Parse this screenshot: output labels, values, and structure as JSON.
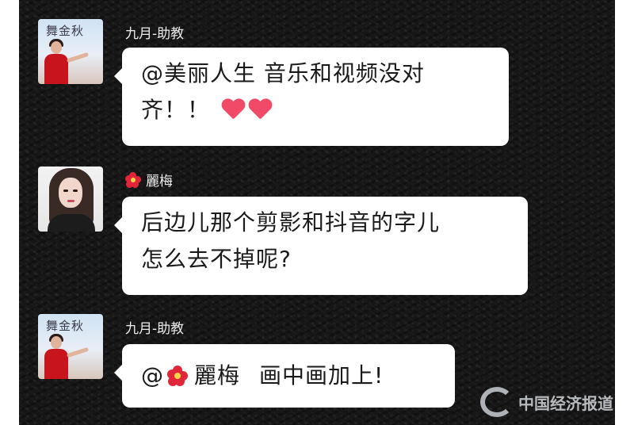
{
  "messages": [
    {
      "sender": "九月-助教",
      "avatar": "teacher-avatar",
      "avatar_sign": "舞金秋",
      "lines": [
        "@美丽人生  音乐和视频没对",
        "齐！！"
      ],
      "emoji": "two-hearts"
    },
    {
      "sender": "麗梅",
      "sender_icon": "hibiscus-icon",
      "avatar": "lady-avatar",
      "lines": [
        "后边儿那个剪影和抖音的字儿",
        "怎么去不掉呢?"
      ]
    },
    {
      "sender": "九月-助教",
      "avatar": "teacher-avatar",
      "avatar_sign": "舞金秋",
      "mention_prefix": "@",
      "mention_name": "麗梅",
      "text": "画中画加上!"
    }
  ],
  "watermark": {
    "text": "中国经济报道"
  },
  "colors": {
    "background": "#161616",
    "bubble": "#ffffff",
    "heart": "#f04a68",
    "hibiscus": "#e2263a"
  }
}
